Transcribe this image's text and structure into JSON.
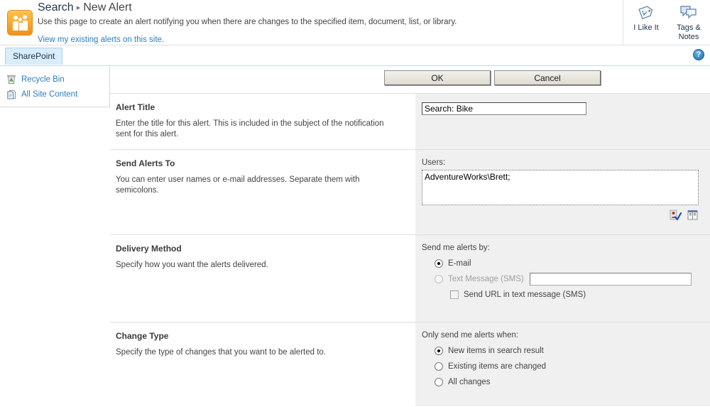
{
  "header": {
    "logo_icon": "sharepoint-people-logo",
    "breadcrumb": {
      "parent": "Search",
      "separator": "▸",
      "current": "New Alert"
    },
    "description": "Use this page to create an alert notifying you when there are changes to the specified item, document, list, or library.",
    "existing_alerts_link": "View my existing alerts on this site.",
    "social_buttons": [
      {
        "label": "I Like It",
        "icon": "tag-smiley-icon"
      },
      {
        "label": "Tags &\nNotes",
        "label_line1": "Tags &",
        "label_line2": "Notes",
        "icon": "tags-notes-icon"
      }
    ]
  },
  "ribbon": {
    "tab_label": "SharePoint",
    "help_icon": "help-question-icon",
    "help_glyph": "?"
  },
  "sidebar": {
    "items": [
      {
        "label": "Recycle Bin",
        "icon": "recycle-bin-icon"
      },
      {
        "label": "All Site Content",
        "icon": "all-site-content-icon"
      }
    ]
  },
  "toolbar": {
    "ok_label": "OK",
    "cancel_label": "Cancel"
  },
  "form": {
    "alert_title": {
      "title": "Alert Title",
      "description": "Enter the title for this alert. This is included in the subject of the notification sent for this alert.",
      "input_value": "Search: Bike",
      "input_placeholder": ""
    },
    "send_alerts_to": {
      "title": "Send Alerts To",
      "description": "You can enter user names or e-mail addresses. Separate them with semicolons.",
      "users_label": "Users:",
      "users_value": "AdventureWorks\\Brett;",
      "users_placeholder": "",
      "check_names_icon": "check-names-icon",
      "address_book_icon": "address-book-icon"
    },
    "delivery_method": {
      "title": "Delivery Method",
      "description": "Specify how you want the alerts delivered.",
      "group_label": "Send me alerts by:",
      "options": [
        {
          "label": "E-mail",
          "selected": true,
          "disabled": false
        },
        {
          "label": "Text Message (SMS)",
          "selected": false,
          "disabled": true
        }
      ],
      "sms_input_value": "",
      "sms_input_placeholder": "",
      "checkbox_label": "Send URL in text message (SMS)",
      "checkbox_checked": false
    },
    "change_type": {
      "title": "Change Type",
      "description": "Specify the type of changes that you want to be alerted to.",
      "group_label": "Only send me alerts when:",
      "options": [
        {
          "label": "New items in search result",
          "selected": true
        },
        {
          "label": "Existing items are changed",
          "selected": false
        },
        {
          "label": "All changes",
          "selected": false
        }
      ]
    }
  },
  "colors": {
    "link": "#2b7ec2",
    "breadcrumb": "#21374c",
    "panel_bg": "#f0f0f0",
    "tab_bg": "#d9edfb",
    "logo_orange": "#f2901d"
  }
}
